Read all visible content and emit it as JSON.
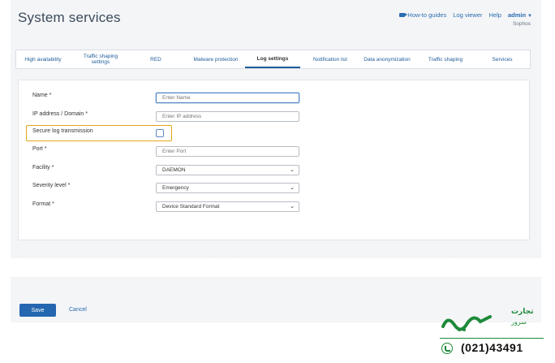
{
  "header": {
    "title": "System services",
    "links": [
      "How-to guides",
      "Log viewer",
      "Help"
    ],
    "user": "admin",
    "org": "Sophos"
  },
  "tabs": [
    {
      "label": "High availability"
    },
    {
      "label": "Traffic shaping settings"
    },
    {
      "label": "RED"
    },
    {
      "label": "Malware protection"
    },
    {
      "label": "Log settings"
    },
    {
      "label": "Notification list"
    },
    {
      "label": "Data anonymization"
    },
    {
      "label": "Traffic shaping"
    },
    {
      "label": "Services"
    }
  ],
  "form": {
    "name_label": "Name *",
    "name_placeholder": "Enter Name",
    "ip_label": "IP address / Domain *",
    "ip_placeholder": "Enter IP address",
    "secure_label": "Secure log transmission",
    "secure_checked": false,
    "port_label": "Port *",
    "port_placeholder": "Enter Port",
    "facility_label": "Facility *",
    "facility_value": "DAEMON",
    "severity_label": "Severity level *",
    "severity_value": "Emergency",
    "format_label": "Format *",
    "format_value": "Device Standard Format"
  },
  "actions": {
    "save": "Save",
    "cancel": "Cancel"
  },
  "branding": {
    "name": "پارسه",
    "tagline_top": "تجارت",
    "tagline_bottom": "سرور",
    "phone": "(021)43491",
    "color": "#1e8a3a"
  },
  "colors": {
    "accent": "#2566b0",
    "highlight": "#e3a61a"
  }
}
